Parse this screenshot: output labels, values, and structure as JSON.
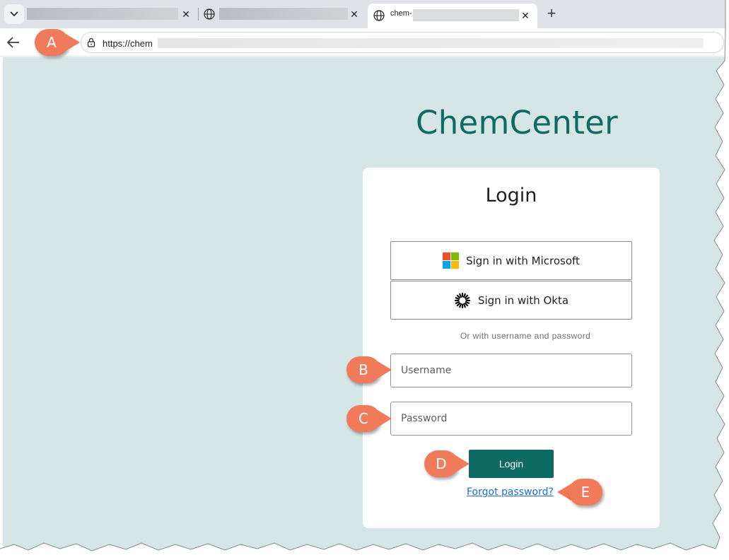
{
  "browser": {
    "tabs": [
      {
        "title": "",
        "active": false
      },
      {
        "title": "",
        "active": false
      },
      {
        "title": "chem-",
        "active": true
      }
    ],
    "new_tab_symbol": "+",
    "tab_close_symbol": "✕",
    "address": {
      "url_prefix": "https://chem"
    }
  },
  "page": {
    "brand": "ChemCenter",
    "card": {
      "title": "Login",
      "sso_buttons": [
        {
          "label": "Sign in with Microsoft",
          "icon": "microsoft-logo-icon"
        },
        {
          "label": "Sign in with Okta",
          "icon": "okta-logo-icon"
        }
      ],
      "divider_text": "Or with username and password",
      "username": {
        "placeholder": "Username",
        "value": ""
      },
      "password": {
        "placeholder": "Password",
        "value": ""
      },
      "login_label": "Login",
      "forgot_label": "Forgot password?"
    }
  },
  "callouts": {
    "a": "A",
    "b": "B",
    "c": "C",
    "d": "D",
    "e": "E"
  },
  "colors": {
    "brand": "#0d6a65",
    "page_bg": "#d6e5e5",
    "callout": "#f07a59",
    "link": "#1a6fd1"
  }
}
